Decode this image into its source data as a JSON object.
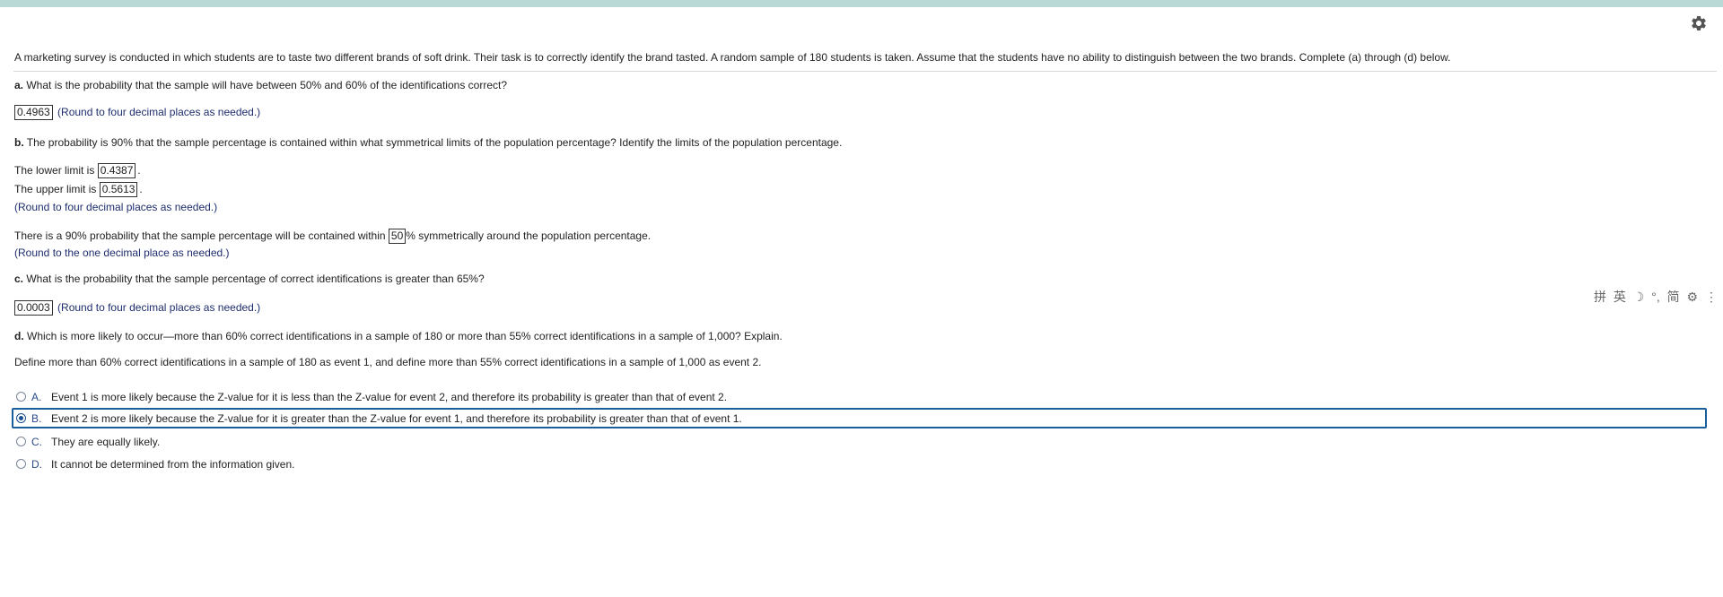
{
  "intro": "A marketing survey is conducted in which students are to taste two different brands of soft drink. Their task is to correctly identify the brand tasted. A random sample of 180 students is taken. Assume that the students have no ability to distinguish between the two brands. Complete (a) through (d) below.",
  "part_a": {
    "label": "a.",
    "question": "What is the probability that the sample will have between 50% and 60% of the identifications correct?",
    "answer": "0.4963",
    "note": "(Round to four decimal places as needed.)"
  },
  "part_b": {
    "label": "b.",
    "question": "The probability is 90% that the sample percentage is contained within what symmetrical limits of the population percentage? Identify the limits of the population percentage.",
    "lower_prefix": "The lower limit is",
    "lower_answer": "0.4387",
    "upper_prefix": "The upper limit is",
    "upper_answer": "0.5613",
    "period": ".",
    "note": "(Round to four decimal places as needed.)",
    "sym_prefix": "There is a 90% probability that the sample percentage will be contained within",
    "sym_answer": "50",
    "sym_suffix": "% symmetrically around the population percentage.",
    "sym_note": "(Round to the one decimal place as needed.)"
  },
  "part_c": {
    "label": "c.",
    "question": "What is the probability that the sample percentage of correct identifications is greater than 65%?",
    "answer": "0.0003",
    "note": "(Round to four decimal places as needed.)"
  },
  "part_d": {
    "label": "d.",
    "question": "Which is more likely to occur—more than 60% correct identifications in a sample of 180 or more than 55% correct identifications in a sample of 1,000? Explain.",
    "definition": "Define more than 60% correct identifications in a sample of 180 as event 1, and define more than 55% correct identifications in a sample of 1,000 as event 2.",
    "options": [
      {
        "letter": "A.",
        "text": "Event 1 is more likely because the Z-value for it is less than the Z-value for event 2, and therefore its probability is greater than that of event 2."
      },
      {
        "letter": "B.",
        "text": "Event 2 is more likely because the Z-value for it is greater than the Z-value for event 1, and therefore its probability is greater than that of event 1."
      },
      {
        "letter": "C.",
        "text": "They are equally likely."
      },
      {
        "letter": "D.",
        "text": "It cannot be determined from the information given."
      }
    ],
    "selected": "B."
  },
  "ime_toolbar": {
    "items": [
      "拼",
      "英",
      "☽",
      "°,",
      "简",
      "⚙",
      "⋮"
    ]
  },
  "colors": {
    "top_bar": "#b8d9d6",
    "note_text": "#1e2d6e",
    "selection_border": "#1b5e9e"
  },
  "icons": {
    "settings": "gear-icon"
  }
}
